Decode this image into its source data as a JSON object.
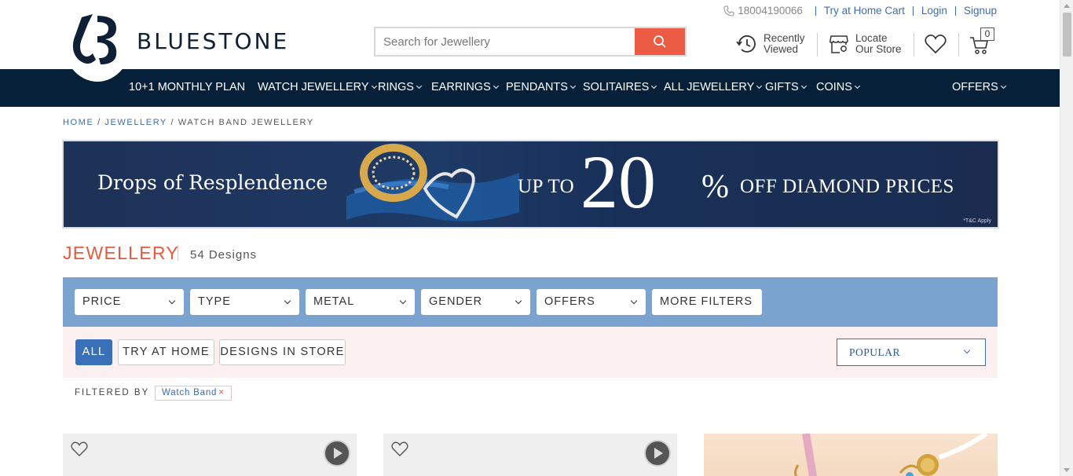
{
  "header": {
    "brand": "BLUESTONE",
    "phone": "18004190066",
    "top_links": [
      "Try at Home Cart",
      "Login",
      "Signup"
    ],
    "search_placeholder": "Search for Jewellery",
    "recently_viewed": [
      "Recently",
      "Viewed"
    ],
    "locate_store": [
      "Locate",
      "Our Store"
    ],
    "cart_count": "0"
  },
  "nav": {
    "items": [
      "10+1 MONTHLY PLAN",
      "WATCH JEWELLERY",
      "RINGS",
      "EARRINGS",
      "PENDANTS",
      "SOLITAIRES",
      "ALL JEWELLERY",
      "GIFTS",
      "COINS",
      "OFFERS"
    ]
  },
  "breadcrumb": [
    "HOME",
    "JEWELLERY",
    "WATCH BAND JEWELLERY"
  ],
  "banner": {
    "tagline": "Drops of Resplendence",
    "up_to": "UP TO",
    "number": "20",
    "percent": "%",
    "offer": "OFF DIAMOND PRICES",
    "terms": "*T&C Apply"
  },
  "listing": {
    "title": "JEWELLERY",
    "count": "54 Designs"
  },
  "filters": [
    "PRICE",
    "TYPE",
    "METAL",
    "GENDER",
    "OFFERS",
    "MORE FILTERS"
  ],
  "tabs": [
    "ALL",
    "TRY AT HOME",
    "DESIGNS IN STORE"
  ],
  "sort": "POPULAR",
  "filtered_by": {
    "label": "FILTERED BY",
    "chip": "Watch Band",
    "remove": "×"
  },
  "colors": {
    "nav_bg": "#06203a",
    "accent": "#ec5c44",
    "filter_bar": "#7aa4cf",
    "link": "#3a6db5"
  }
}
